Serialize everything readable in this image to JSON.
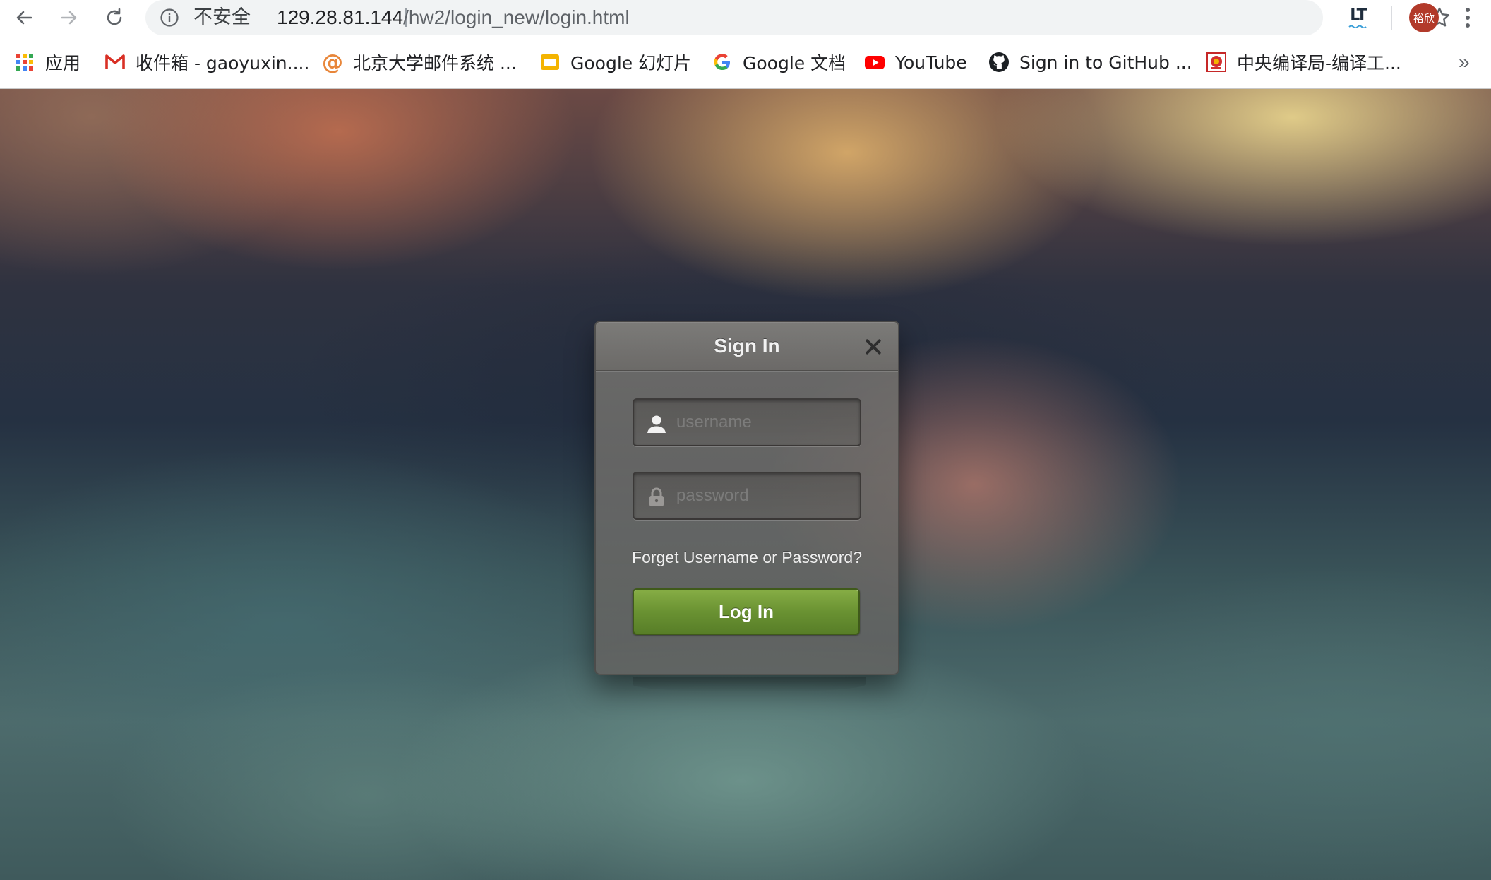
{
  "browser": {
    "security_label": "不安全",
    "url_host": "129.28.81.144",
    "url_path": "/hw2/login_new/login.html",
    "avatar_text": "裕欣",
    "extension_label": "LT",
    "bookmarks": [
      {
        "label": "应用",
        "icon": "apps-grid-icon"
      },
      {
        "label": "收件箱 - gaoyuxin....",
        "icon": "gmail-icon"
      },
      {
        "label": "北京大学邮件系统 ...",
        "icon": "at-sign-icon"
      },
      {
        "label": "Google 幻灯片",
        "icon": "google-slides-icon"
      },
      {
        "label": "Google 文档",
        "icon": "google-g-icon"
      },
      {
        "label": "YouTube",
        "icon": "youtube-icon"
      },
      {
        "label": "Sign in to GitHub ...",
        "icon": "github-icon"
      },
      {
        "label": "中央编译局-编译工...",
        "icon": "bookmark-emblem-icon"
      }
    ],
    "overflow_label": "»"
  },
  "login": {
    "title": "Sign In",
    "username_placeholder": "username",
    "password_placeholder": "password",
    "forgot_label": "Forget Username or Password?",
    "submit_label": "Log In"
  },
  "colors": {
    "login_button": "#6a9232",
    "avatar": "#b23a2a",
    "youtube_red": "#ff0000",
    "slides_yellow": "#f4b400"
  }
}
